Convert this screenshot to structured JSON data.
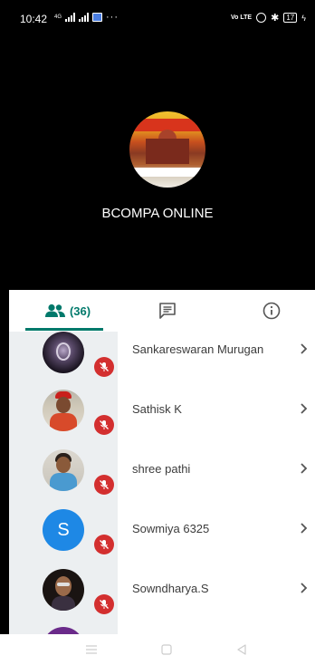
{
  "status_bar": {
    "time": "10:42",
    "network_label": "4G",
    "volte_label": "Vo LTE",
    "battery_level": "17",
    "icons": [
      "signal-icon",
      "message-icon",
      "circle-icon",
      "bluetooth-icon",
      "battery-icon",
      "charging-icon"
    ]
  },
  "meeting": {
    "name": "BCOMPA ONLINE"
  },
  "tabs": {
    "people_count": "(36)",
    "active": "people"
  },
  "participants": [
    {
      "name": "Sankareswaran Murugan",
      "avatar": "photo",
      "muted": true
    },
    {
      "name": "Sathisk K",
      "avatar": "photo",
      "muted": true
    },
    {
      "name": "shree pathi",
      "avatar": "photo",
      "muted": true
    },
    {
      "name": "Sowmiya 6325",
      "avatar": "letter",
      "letter": "S",
      "muted": true
    },
    {
      "name": "Sowndharya.S",
      "avatar": "photo",
      "muted": true
    }
  ],
  "colors": {
    "accent": "#00796b",
    "mute_badge": "#d32f2f",
    "letter_avatar": "#1e88e5"
  }
}
